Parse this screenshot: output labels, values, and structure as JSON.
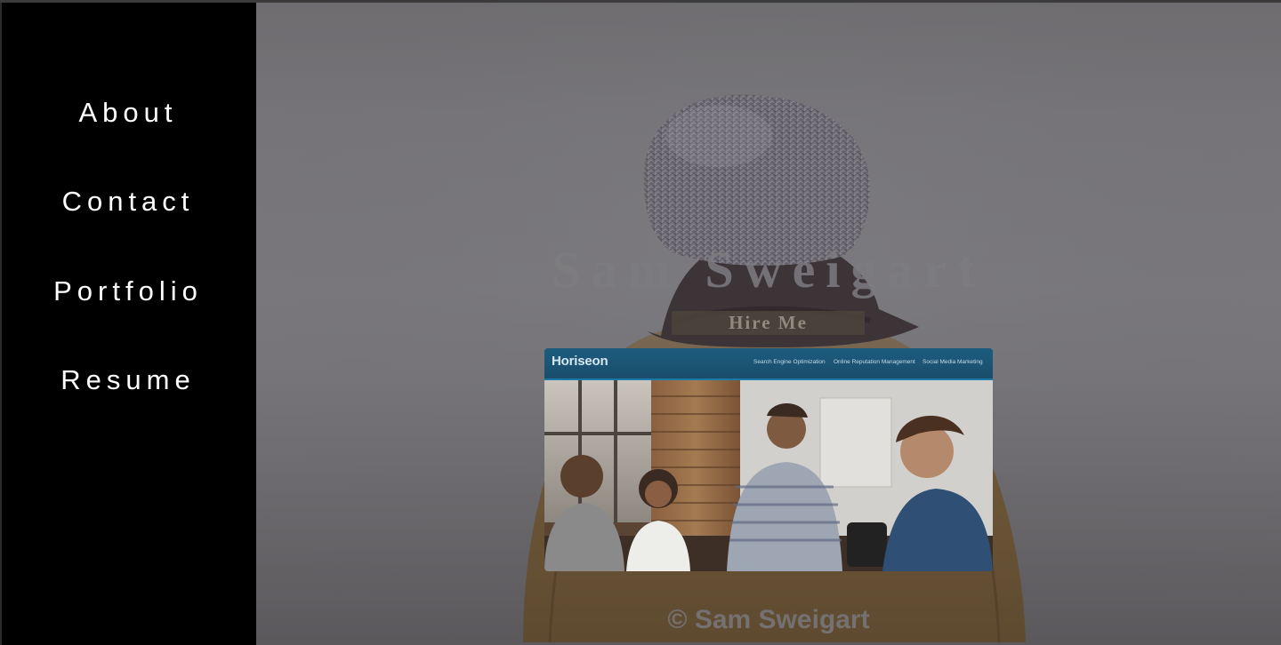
{
  "nav": {
    "about": "About",
    "contact": "Contact",
    "portfolio": "Portfolio",
    "resume": "Resume"
  },
  "hero": {
    "title": "Sam Sweigart",
    "hire_label": "Hire Me"
  },
  "portfolio_card": {
    "site_logo": "Horiseon",
    "site_nav": [
      "Search Engine Optimization",
      "Online Reputation Management",
      "Social Media Marketing"
    ]
  },
  "footer": {
    "copyright": "© Sam Sweigart"
  },
  "colors": {
    "sidebar": "#000000",
    "nav_text": "#ffffff",
    "hero_overlay": "#757377",
    "card_header": "#1d5c7f"
  }
}
